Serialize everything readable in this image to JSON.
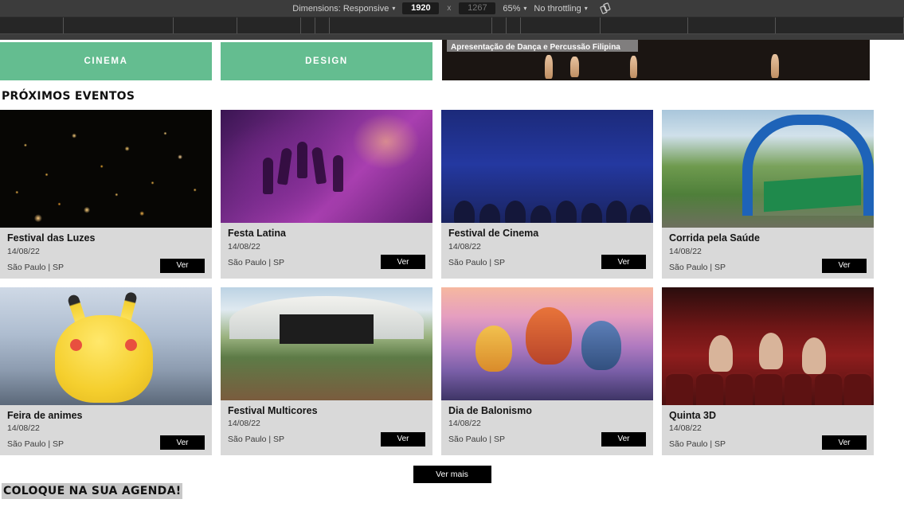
{
  "devtools": {
    "dimensions_label": "Dimensions: Responsive",
    "width_value": "1920",
    "height_value": "1267",
    "x_separator": "x",
    "zoom_value": "65%",
    "throttling_label": "No throttling",
    "rotate_icon": "rotate-device-icon",
    "caret": "▾"
  },
  "page": {
    "categories": [
      {
        "label": "CINEMA"
      },
      {
        "label": "DESIGN"
      }
    ],
    "hero": {
      "caption": "Apresentação de Dança e Percussão Filipina"
    },
    "sections": {
      "upcoming_title": "PRÓXIMOS EVENTOS",
      "agenda_title": "COLOQUE NA SUA AGENDA!"
    },
    "events": [
      {
        "title": "Festival das Luzes",
        "date": "14/08/22",
        "location": "São Paulo | SP",
        "button": "Ver",
        "art": "lanterns"
      },
      {
        "title": "Festa Latina",
        "date": "14/08/22",
        "location": "São Paulo | SP",
        "button": "Ver",
        "art": "concert"
      },
      {
        "title": "Festival de Cinema",
        "date": "14/08/22",
        "location": "São Paulo | SP",
        "button": "Ver",
        "art": "cinema-audience"
      },
      {
        "title": "Corrida pela Saúde",
        "date": "14/08/22",
        "location": "São Paulo | SP",
        "button": "Ver",
        "art": "race"
      },
      {
        "title": "Feira de animes",
        "date": "14/08/22",
        "location": "São Paulo | SP",
        "button": "Ver",
        "art": "pikachu"
      },
      {
        "title": "Festival Multicores",
        "date": "14/08/22",
        "location": "São Paulo | SP",
        "button": "Ver",
        "art": "festival"
      },
      {
        "title": "Dia de Balonismo",
        "date": "14/08/22",
        "location": "São Paulo | SP",
        "button": "Ver",
        "art": "balloons"
      },
      {
        "title": "Quinta 3D",
        "date": "14/08/22",
        "location": "São Paulo | SP",
        "button": "Ver",
        "art": "cinema-3d"
      }
    ],
    "load_more_label": "Ver mais"
  },
  "colors": {
    "category_green": "#64bd90",
    "card_bg": "#d9d9d9",
    "button_black": "#000000",
    "toolbar_bg": "#3c3c3c"
  }
}
